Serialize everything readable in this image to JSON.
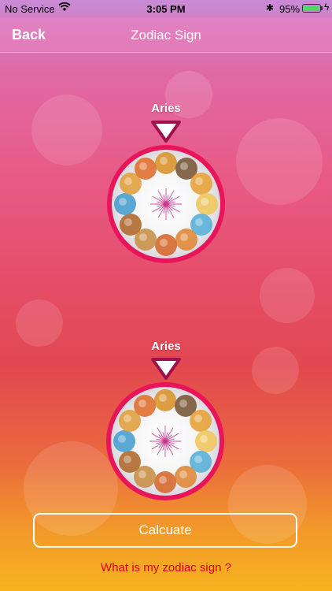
{
  "status_bar": {
    "carrier": "No Service",
    "time": "3:05 PM",
    "battery_percent": "95%",
    "battery_level": 0.95
  },
  "nav": {
    "back_label": "Back",
    "title": "Zodiac Sign"
  },
  "wheels": [
    {
      "sign_label": "Aries"
    },
    {
      "sign_label": "Aries"
    }
  ],
  "actions": {
    "calculate_label": "Calcuate",
    "help_link": "What is my zodiac sign ?"
  },
  "colors": {
    "wheel_rim": "#e8155a",
    "pointer": "#a0104a",
    "help_link": "#e0001e"
  }
}
